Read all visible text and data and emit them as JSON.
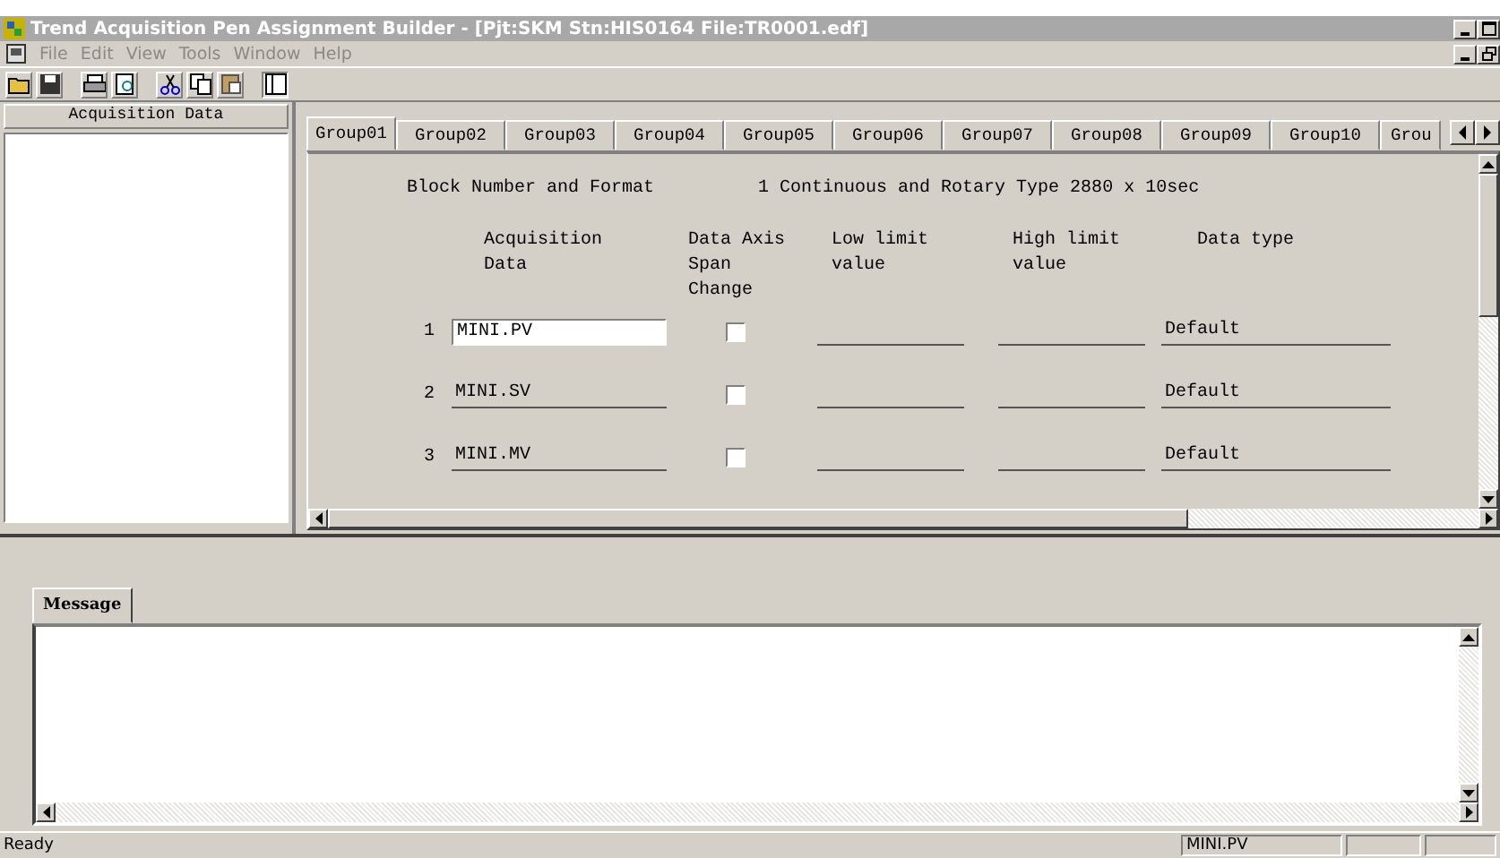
{
  "window": {
    "title": "Trend Acquisition Pen Assignment Builder - [Pjt:SKM Stn:HIS0164 File:TR0001.edf]"
  },
  "menu": [
    "File",
    "Edit",
    "View",
    "Tools",
    "Window",
    "Help"
  ],
  "sidebar": {
    "header": "Acquisition Data"
  },
  "tabs": [
    {
      "label": "Group01",
      "selected": true
    },
    {
      "label": "Group02",
      "selected": false
    },
    {
      "label": "Group03",
      "selected": false
    },
    {
      "label": "Group04",
      "selected": false
    },
    {
      "label": "Group05",
      "selected": false
    },
    {
      "label": "Group06",
      "selected": false
    },
    {
      "label": "Group07",
      "selected": false
    },
    {
      "label": "Group08",
      "selected": false
    },
    {
      "label": "Group09",
      "selected": false
    },
    {
      "label": "Group10",
      "selected": false
    },
    {
      "label": "Grou",
      "selected": false
    }
  ],
  "block": {
    "label": "Block Number and Format",
    "value": "1 Continuous and Rotary Type 2880 x 10sec"
  },
  "columns": [
    "Acquisition\nData",
    "Data Axis\nSpan Change",
    "Low limit\nvalue",
    "High limit\nvalue",
    "Data type"
  ],
  "rows": [
    {
      "number": "1",
      "data": "MINI.PV",
      "focused": true,
      "span_change": false,
      "data_type": "Default"
    },
    {
      "number": "2",
      "data": "MINI.SV",
      "focused": false,
      "span_change": false,
      "data_type": "Default"
    },
    {
      "number": "3",
      "data": "MINI.MV",
      "focused": false,
      "span_change": false,
      "data_type": "Default"
    }
  ],
  "message_tabs": [
    {
      "label": "Message",
      "selected": true
    }
  ],
  "status_bar": {
    "text": "Ready",
    "panes": [
      "MINI.PV"
    ]
  }
}
